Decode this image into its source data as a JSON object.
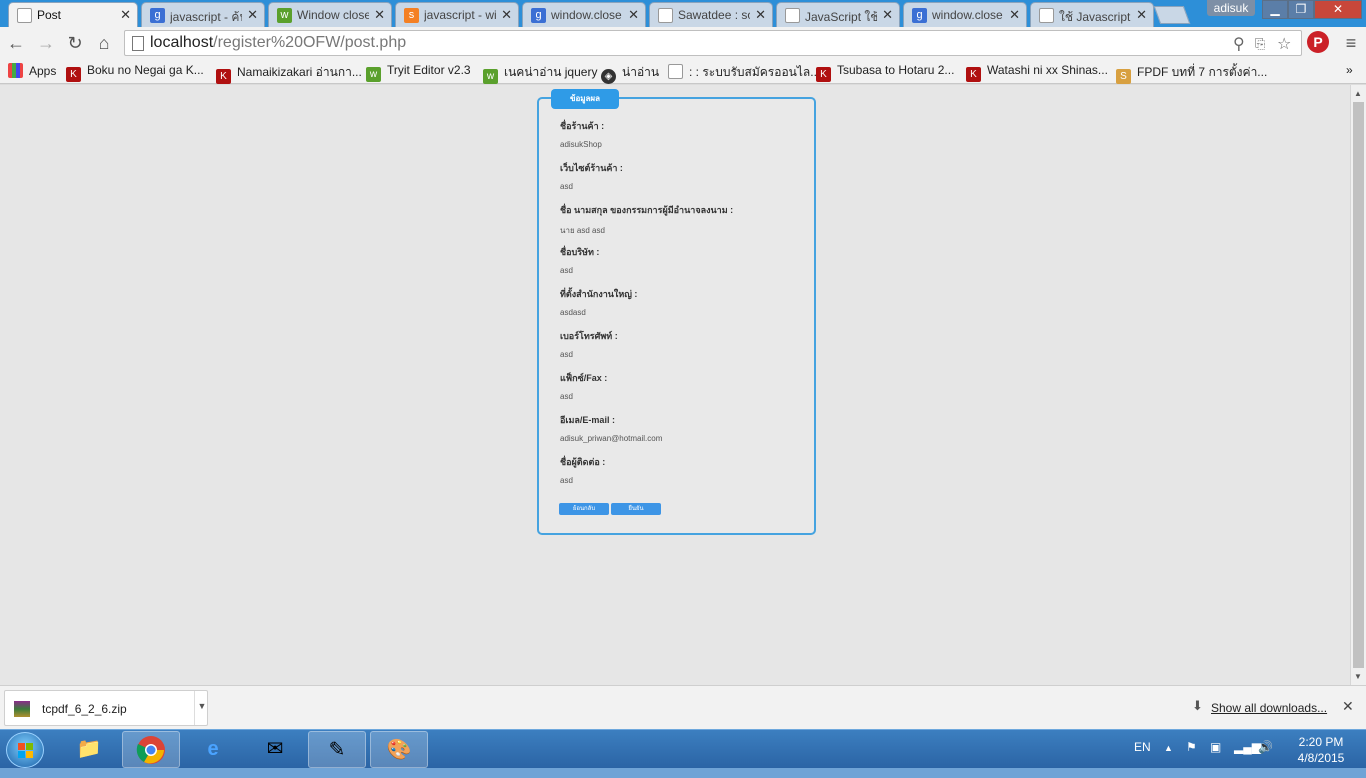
{
  "browser": {
    "tabs": [
      {
        "label": "Post",
        "icon": "page-icon",
        "active": true
      },
      {
        "label": "javascript - ค้นหาด้วย Google",
        "icon": "google-icon"
      },
      {
        "label": "Window close",
        "icon": "w3-icon"
      },
      {
        "label": "javascript - window",
        "icon": "stackoverflow-icon"
      },
      {
        "label": "window.close",
        "icon": "google-icon"
      },
      {
        "label": "Sawatdee : so",
        "icon": "page-icon"
      },
      {
        "label": "JavaScript ใช้",
        "icon": "page-icon"
      },
      {
        "label": "window.close",
        "icon": "google-icon"
      },
      {
        "label": "ใช้ Javascript",
        "icon": "page-icon"
      }
    ],
    "user": "adisuk",
    "url_host": "localhost",
    "url_path": "/register%20OFW/post.php",
    "bookmarks": [
      {
        "label": "Apps",
        "icon": "apps-grid-icon"
      },
      {
        "label": "Boku no Negai ga K...",
        "icon": "manga-icon"
      },
      {
        "label": "Namaikizakari อ่านกา...",
        "icon": "manga-icon"
      },
      {
        "label": "Tryit Editor v2.3",
        "icon": "w3-icon"
      },
      {
        "label": "เนคน่าอ่าน jquery",
        "icon": "w3-icon"
      },
      {
        "label": "น่าอ่าน",
        "icon": "diamond-icon"
      },
      {
        "label": ": : ระบบรับสมัครออนไล...",
        "icon": "page-icon"
      },
      {
        "label": "Tsubasa to Hotaru 2...",
        "icon": "manga-icon"
      },
      {
        "label": "Watashi ni xx Shinas...",
        "icon": "manga-icon"
      },
      {
        "label": "FPDF บทที่ 7 การตั้งค่า...",
        "icon": "fpdf-icon"
      }
    ]
  },
  "form": {
    "title": "ข้อมูลผล",
    "fields": [
      {
        "label": "ชื่อร้านค้า :",
        "value": "adisukShop"
      },
      {
        "label": "เว็บไซต์ร้านค้า :",
        "value": "asd"
      },
      {
        "label": "ชื่อ นามสกุล ของกรรมการผู้มีอำนาจลงนาม :",
        "value": "นาย asd   asd"
      },
      {
        "label": "ชื่อบริษัท :",
        "value": "asd"
      },
      {
        "label": "ที่ตั้งสำนักงานใหญ่ :",
        "value": "asdasd"
      },
      {
        "label": "เบอร์โทรศัพท์ :",
        "value": "asd"
      },
      {
        "label": "แฟ็กซ์/Fax :",
        "value": "asd"
      },
      {
        "label": "อีเมล/E-mail :",
        "value": "adisuk_priwan@hotmail.com"
      },
      {
        "label": "ชื่อผู้ติดต่อ :",
        "value": "asd"
      }
    ],
    "back_button": "ย้อนกลับ",
    "confirm_button": "ยืนยัน"
  },
  "downloads": {
    "file": "tcpdf_6_2_6.zip",
    "show_all": "Show all downloads..."
  },
  "taskbar": {
    "language": "EN",
    "time": "2:20 PM",
    "date": "4/8/2015"
  },
  "colors": {
    "accent": "#2f9be7",
    "tabstrip": "#2d8fd8"
  }
}
